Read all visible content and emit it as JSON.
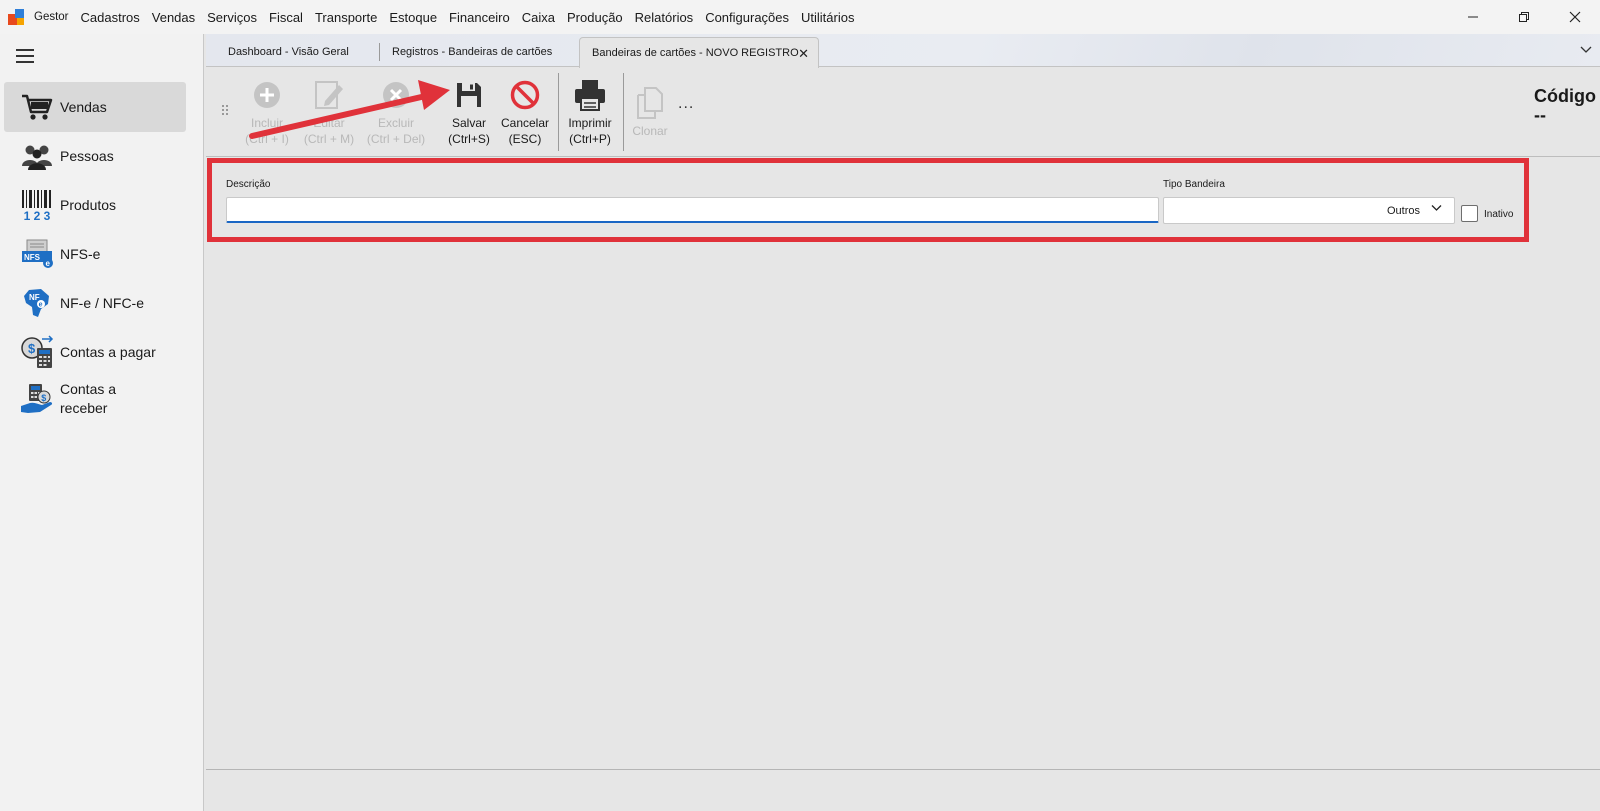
{
  "menu": {
    "items": [
      "Gestor",
      "Cadastros",
      "Vendas",
      "Serviços",
      "Fiscal",
      "Transporte",
      "Estoque",
      "Financeiro",
      "Caixa",
      "Produção",
      "Relatórios",
      "Configurações",
      "Utilitários"
    ]
  },
  "window": {
    "minimize": "—",
    "restore": "❐",
    "close": "✕"
  },
  "sidebar": {
    "items": [
      {
        "label": "Vendas",
        "icon": "shopping-cart-icon"
      },
      {
        "label": "Pessoas",
        "icon": "people-icon"
      },
      {
        "label": "Produtos",
        "icon": "barcode-icon"
      },
      {
        "label": "NFS-e",
        "icon": "nfse-document-icon"
      },
      {
        "label": "NF-e / NFC-e",
        "icon": "nfe-map-icon"
      },
      {
        "label": "Contas a pagar",
        "icon": "calculator-money-icon"
      },
      {
        "label": "Contas a receber",
        "icon": "hand-money-icon"
      }
    ]
  },
  "tabs": [
    {
      "label": "Dashboard - Visão Geral"
    },
    {
      "label": "Registros - Bandeiras de cartões"
    },
    {
      "label": "Bandeiras de cartões - NOVO REGISTRO",
      "active": true,
      "close": "✕"
    }
  ],
  "tab_overflow": "⌄",
  "toolbar": {
    "incluir": {
      "label": "Incluir",
      "shortcut": "(Ctrl + I)",
      "enabled": false
    },
    "editar": {
      "label": "Editar",
      "shortcut": "(Ctrl + M)",
      "enabled": false
    },
    "excluir": {
      "label": "Excluir",
      "shortcut": "(Ctrl + Del)",
      "enabled": false
    },
    "salvar": {
      "label": "Salvar",
      "shortcut": "(Ctrl+S)",
      "enabled": true
    },
    "cancelar": {
      "label": "Cancelar",
      "shortcut": "(ESC)",
      "enabled": true
    },
    "imprimir": {
      "label": "Imprimir",
      "shortcut": "(Ctrl+P)",
      "enabled": true
    },
    "clonar": {
      "label": "Clonar",
      "enabled": false
    },
    "more": "..."
  },
  "codigo": {
    "label": "Código",
    "value": "--"
  },
  "form": {
    "descricao": {
      "label": "Descrição",
      "value": ""
    },
    "tipo_bandeira": {
      "label": "Tipo Bandeira",
      "value": "Outros"
    },
    "inativo": {
      "label": "Inativo",
      "checked": false
    }
  },
  "colors": {
    "annotation": "#e0323a",
    "cancel_red": "#e0323a",
    "input_focus": "#1a66c4",
    "accent_blue": "#2f7fd8"
  }
}
